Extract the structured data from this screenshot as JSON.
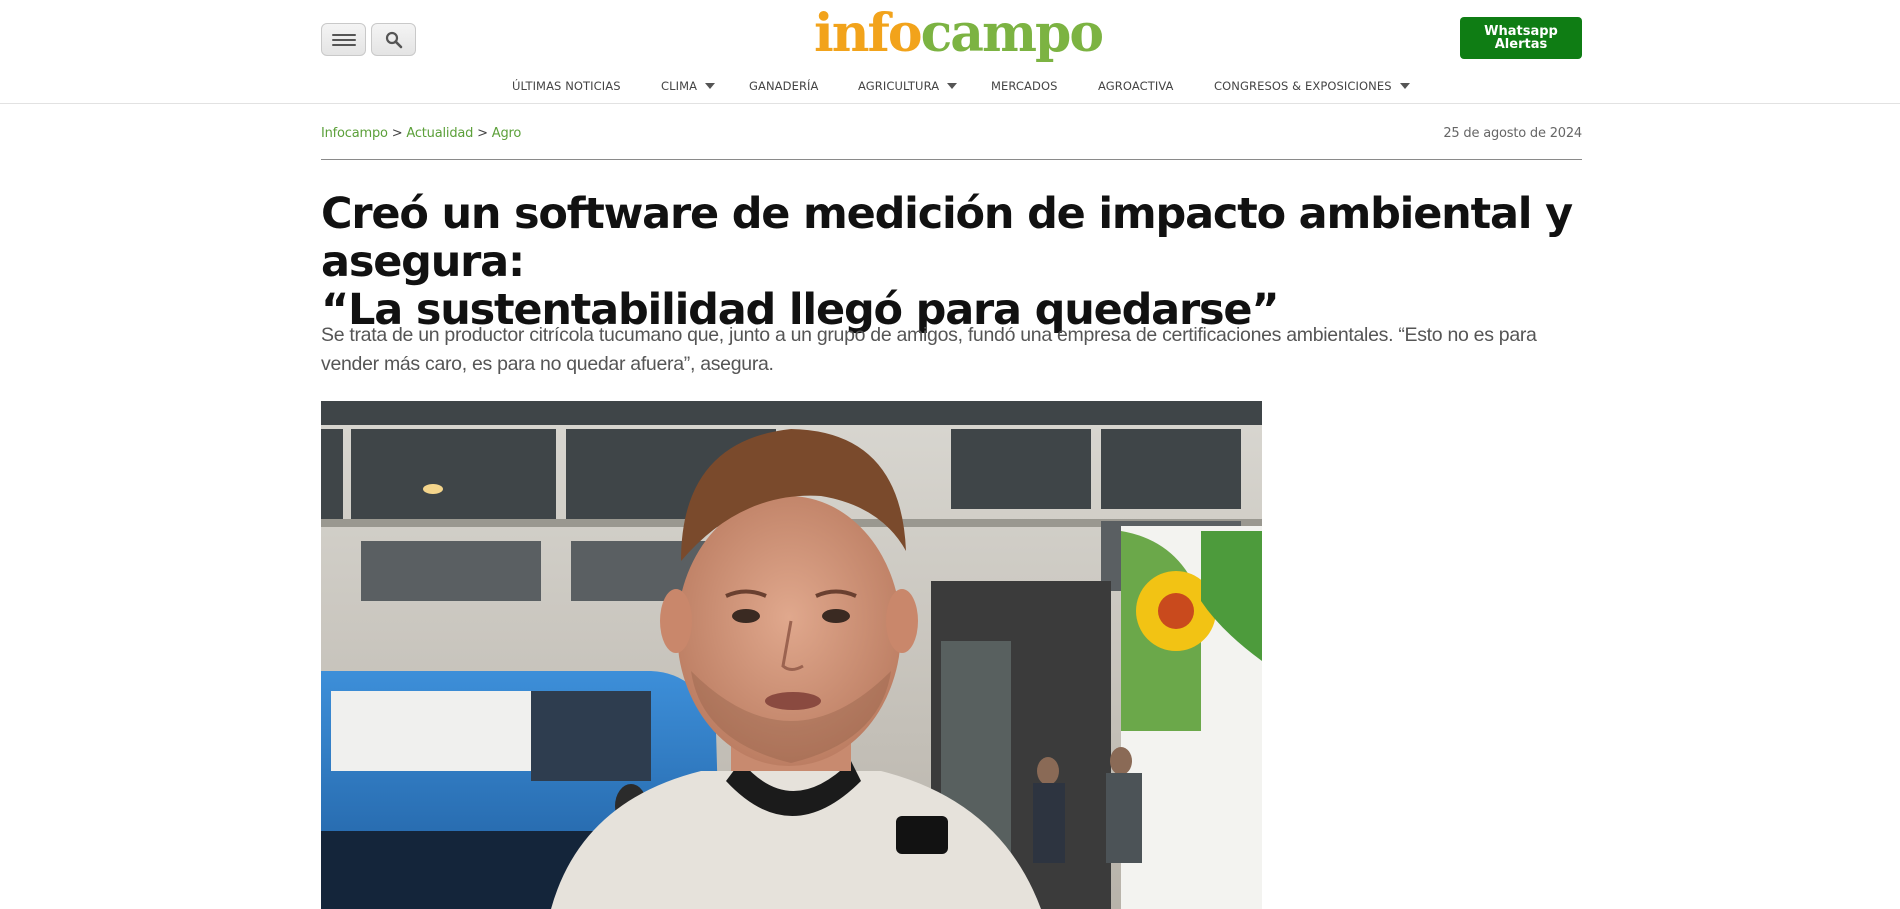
{
  "header": {
    "menu_icon": "hamburger-menu-icon",
    "search_icon": "search-icon",
    "logo_info": "info",
    "logo_campo": "campo",
    "whatsapp_line1": "Whatsapp",
    "whatsapp_line2": "Alertas",
    "colors": {
      "logo_orange": "#f2a31b",
      "logo_green": "#7cb342",
      "whatsapp_green": "#0f7d14"
    }
  },
  "nav": {
    "items": [
      {
        "label": "ÚLTIMAS NOTICIAS",
        "has_dropdown": false
      },
      {
        "label": "CLIMA",
        "has_dropdown": true
      },
      {
        "label": "GANADERÍA",
        "has_dropdown": false
      },
      {
        "label": "AGRICULTURA",
        "has_dropdown": true
      },
      {
        "label": "MERCADOS",
        "has_dropdown": false
      },
      {
        "label": "AGROACTIVA",
        "has_dropdown": false
      },
      {
        "label": "CONGRESOS & EXPOSICIONES",
        "has_dropdown": true
      }
    ]
  },
  "breadcrumb": {
    "items": [
      "Infocampo",
      "Actualidad",
      "Agro"
    ],
    "separator": ">"
  },
  "article": {
    "date": "25 de agosto de 2024",
    "title_line1": "Creó un software de medición de impacto ambiental y asegura:",
    "title_line2": "“La sustentabilidad llegó para quedarse”",
    "lede": "Se trata de un productor citrícola tucumano que, junto a un grupo de amigos, fundó una empresa de certificaciones ambientales. “Esto no es para vender más caro, es para no quedar afuera”, asegura."
  }
}
